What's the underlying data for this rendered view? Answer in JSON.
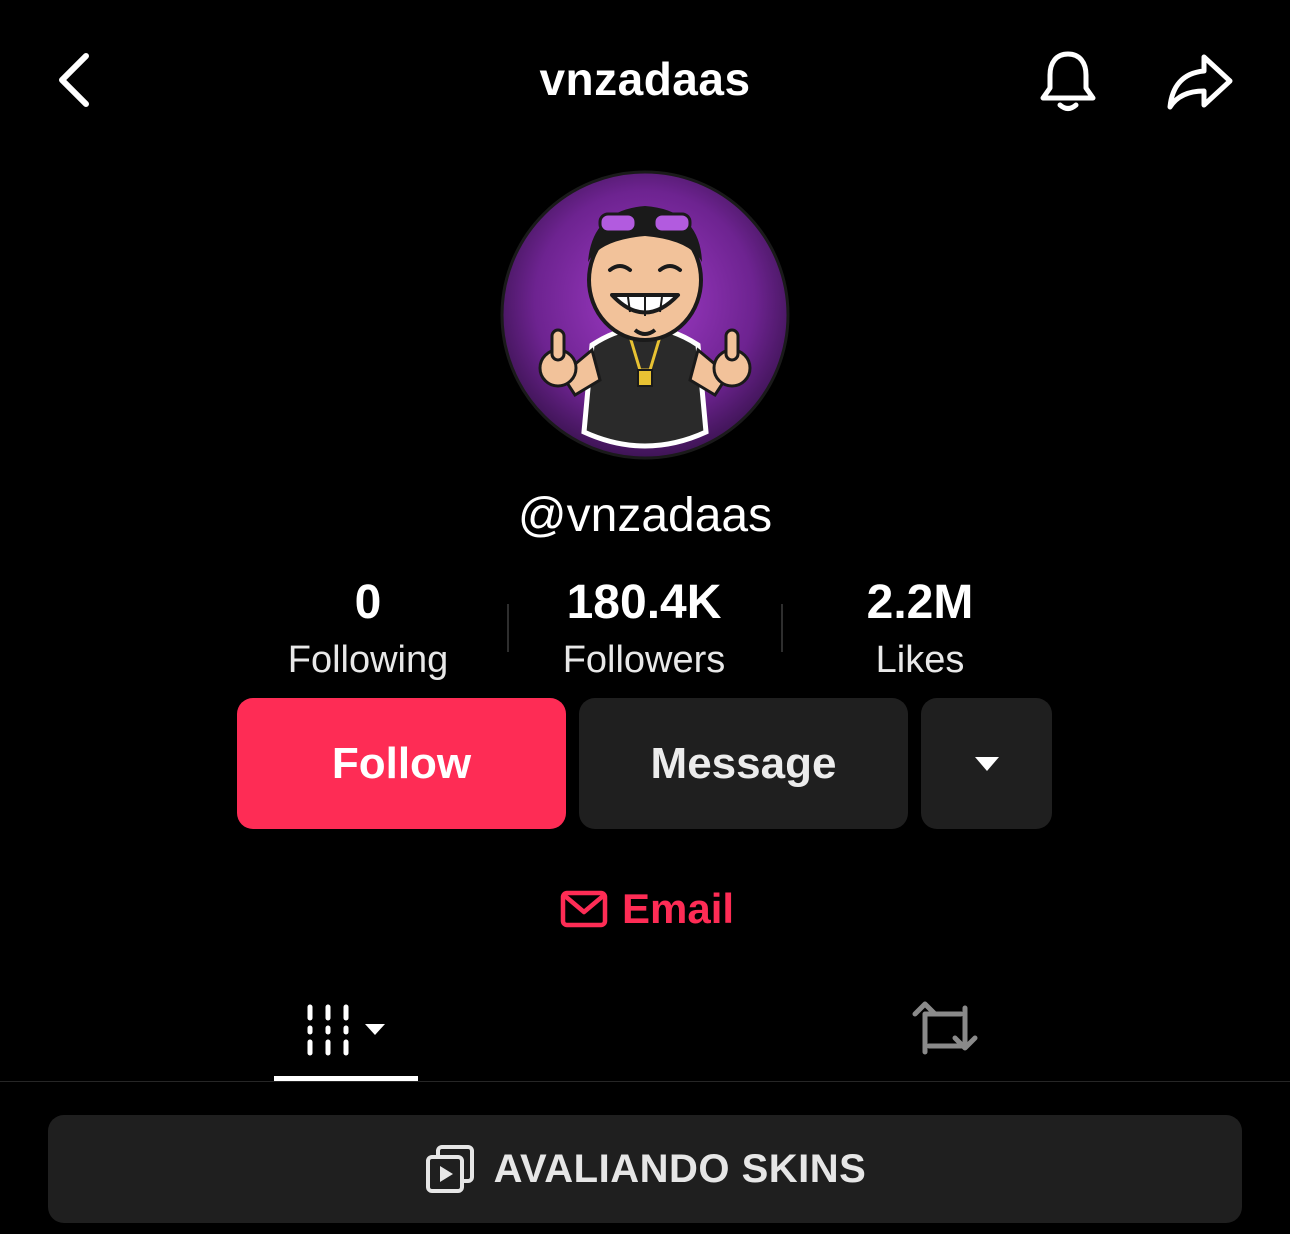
{
  "header": {
    "title": "vnzadaas",
    "back_icon": "chevron-left-icon",
    "notification_icon": "bell-icon",
    "share_icon": "share-arrow-icon"
  },
  "profile": {
    "handle": "@vnzadaas",
    "avatar": "cartoon-avatar-thumbs-up"
  },
  "stats": [
    {
      "value": "0",
      "label": "Following"
    },
    {
      "value": "180.4K",
      "label": "Followers"
    },
    {
      "value": "2.2M",
      "label": "Likes"
    }
  ],
  "actions": {
    "follow_label": "Follow",
    "message_label": "Message",
    "more_icon": "caret-down-icon"
  },
  "email": {
    "label": "Email",
    "icon": "envelope-icon"
  },
  "tabs": [
    {
      "name": "videos",
      "icon": "grid-lines-icon",
      "selected": true
    },
    {
      "name": "reposts",
      "icon": "repost-icon",
      "selected": false
    }
  ],
  "playlist": {
    "label": "AVALIANDO SKINS",
    "icon": "playlist-icon"
  },
  "colors": {
    "accent": "#fe2c55",
    "background": "#000000",
    "button_dark": "#1f1f1f",
    "avatar_purple": "#7b2a9e"
  }
}
